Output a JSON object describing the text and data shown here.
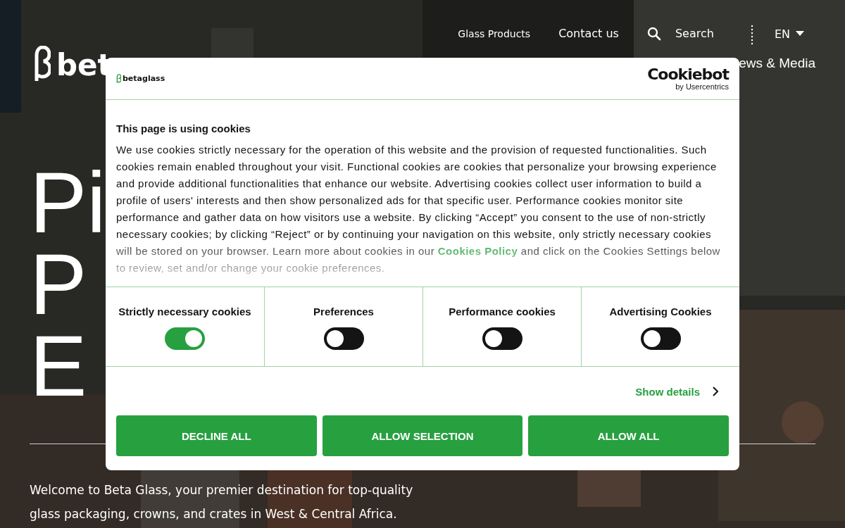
{
  "top_nav": [
    {
      "label": "Glass Products",
      "kind": "small"
    },
    {
      "label": "Contact us",
      "kind": "large"
    }
  ],
  "search": {
    "label": "Search"
  },
  "language": {
    "label": "EN"
  },
  "logo": {
    "text": "bet"
  },
  "main_nav": [
    {
      "label": "ews & Media"
    }
  ],
  "hero": {
    "headline": [
      "Pi",
      "P",
      "E"
    ],
    "intro": "Welcome to Beta Glass, your premier destination for top-quality glass packaging, crowns, and crates in West & Central Africa."
  },
  "cookie_dialog": {
    "brand": "betaglass",
    "provider": "Cookiebot",
    "provider_sub": "by Usercentrics",
    "title": "This page is using cookies",
    "text_before_link": "We use cookies strictly necessary for the operation of this website and the provision of requested functionalities. Such cookies remain enabled throughout your visit. Functional cookies are cookies that personalize your browsing experience and provide additional functionalities that enhance our website. Advertising cookies collect user information to build a profile of users' interests and then show personalized ads for that specific user. Performance cookies monitor site performance and gather data on how visitors use a website.   By clicking “Accept” you consent to the use of non-strictly necessary cookies; by clicking “Reject” or by continuing your navigation on this website, only strictly necessary cookies will be stored on your browser. Learn more about cookies in our",
    "link": "Cookies Policy",
    "text_after_link": "and click on the Cookies Settings below to review, set and/or change your cookie preferences.",
    "categories": [
      {
        "label": "Strictly necessary cookies",
        "checked": true
      },
      {
        "label": "Preferences",
        "checked": false
      },
      {
        "label": "Performance cookies",
        "checked": false
      },
      {
        "label": "Advertising Cookies",
        "checked": false
      }
    ],
    "details_link": "Show details",
    "buttons": [
      "DECLINE ALL",
      "ALLOW SELECTION",
      "ALLOW ALL"
    ]
  }
}
